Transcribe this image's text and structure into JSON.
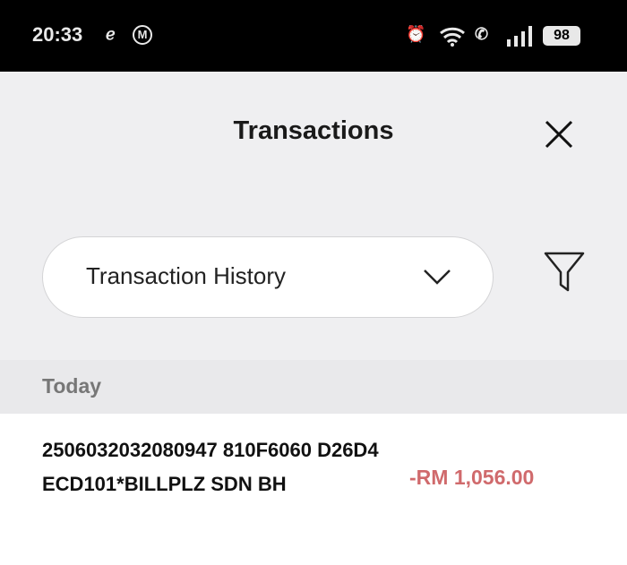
{
  "status_bar": {
    "time": "20:33",
    "battery": "98",
    "icons": [
      "notification-e-icon",
      "notification-m-icon",
      "alarm-icon",
      "wifi-icon",
      "wifi-call-icon",
      "signal-icon",
      "battery-icon"
    ]
  },
  "header": {
    "title": "Transactions",
    "close_icon": "close-icon"
  },
  "filter": {
    "selected": "Transaction History",
    "dropdown_icon": "chevron-down-icon",
    "filter_icon": "filter-icon"
  },
  "groups": [
    {
      "label": "Today",
      "transactions": [
        {
          "description": "2506032032080947 810F6060 D26D4ECD101*BILLPLZ SDN BH",
          "amount": "-RM 1,056.00"
        }
      ]
    }
  ],
  "colors": {
    "debit": "#d06a6c",
    "header_bg": "#efeff1"
  }
}
